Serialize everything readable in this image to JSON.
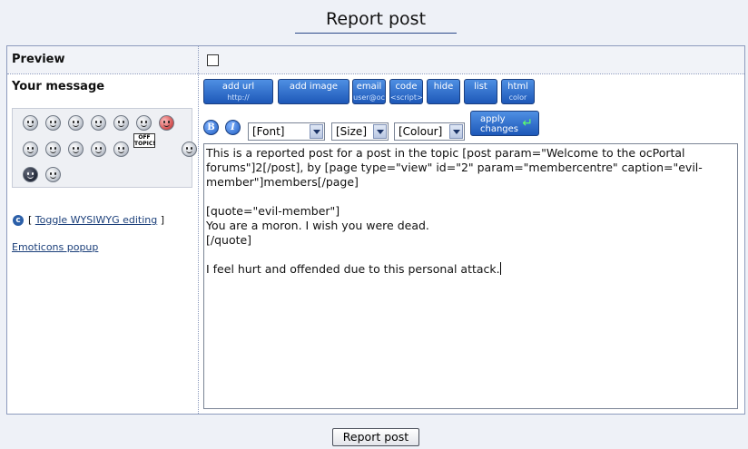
{
  "page": {
    "title": "Report post"
  },
  "form": {
    "preview_label": "Preview",
    "message_label": "Your message",
    "toggle_prefix": "[",
    "toggle_label": "Toggle WYSIWYG editing",
    "toggle_suffix": "]",
    "emoticons_popup": "Emoticons popup",
    "submit_label": "Report post"
  },
  "toolbar": {
    "buttons": [
      {
        "label": "add url",
        "sub": "http://"
      },
      {
        "label": "add image",
        "sub": ""
      },
      {
        "label": "email",
        "sub": "user@oc"
      },
      {
        "label": "code",
        "sub": "<script>"
      },
      {
        "label": "hide",
        "sub": ""
      },
      {
        "label": "list",
        "sub": ""
      },
      {
        "label": "html",
        "sub": "color"
      }
    ],
    "bold_label": "B",
    "italic_label": "I",
    "font_select": "[Font]",
    "size_select": "[Size]",
    "colour_select": "[Colour]",
    "apply_label": "apply changes"
  },
  "emoticons": {
    "offtopic_label": "OFF TOPIC!"
  },
  "message": {
    "text": "This is a reported post for a post in the topic [post param=\"Welcome to the ocPortal forums\"]2[/post], by [page type=\"view\" id=\"2\" param=\"membercentre\" caption=\"evil-member\"]members[/page]\n\n[quote=\"evil-member\"]\nYou are a moron. I wish you were dead.\n[/quote]\n\nI feel hurt and offended due to this personal attack."
  }
}
